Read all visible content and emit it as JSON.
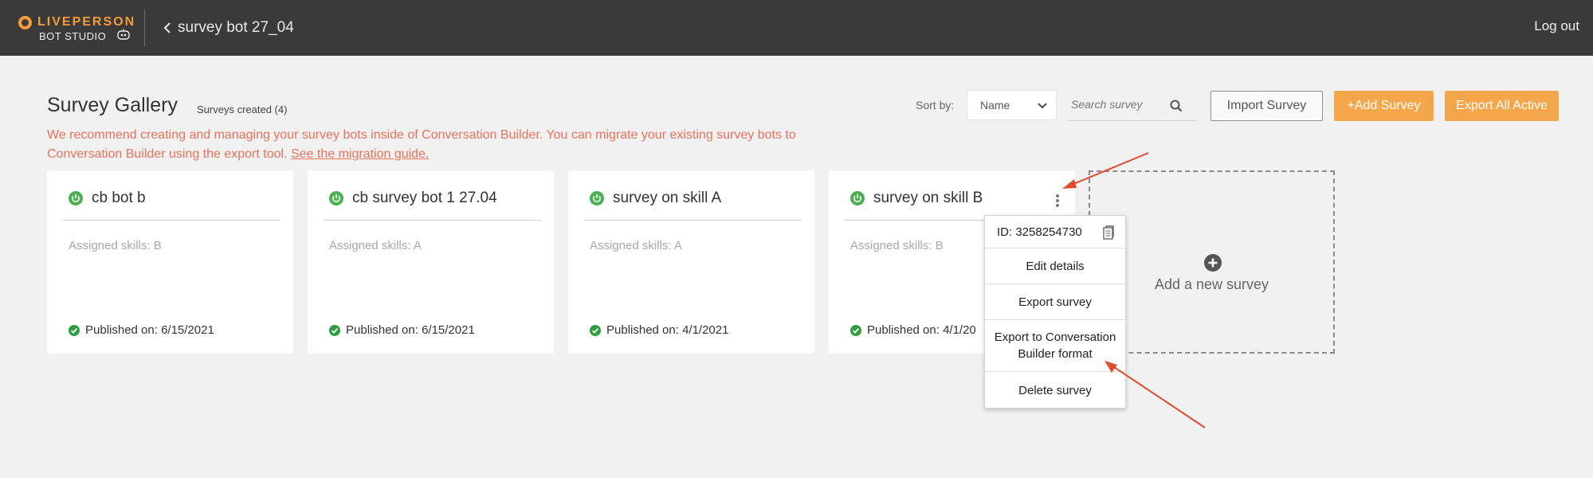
{
  "header": {
    "brand": "LIVEPERSON",
    "product": "BOT STUDIO",
    "back_title": "survey bot 27_04",
    "logout": "Log out"
  },
  "gallery": {
    "title": "Survey Gallery",
    "count_label": "Surveys created (4)",
    "notice": "We recommend creating and managing your survey bots inside of Conversation Builder. You can migrate your existing survey bots to Conversation Builder using the export tool.",
    "notice_link": "See the migration guide."
  },
  "toolbar": {
    "sort_label": "Sort by:",
    "sort_value": "Name",
    "search_placeholder": "Search survey",
    "import_label": "Import Survey",
    "add_label": "+Add Survey",
    "export_all_label": "Export All Active"
  },
  "surveys": [
    {
      "name": "cb bot b",
      "skills": "Assigned skills: B",
      "published": "Published on: 6/15/2021"
    },
    {
      "name": "cb survey bot 1 27.04",
      "skills": "Assigned skills: A",
      "published": "Published on: 6/15/2021"
    },
    {
      "name": "survey on skill A",
      "skills": "Assigned skills: A",
      "published": "Published on: 4/1/2021"
    },
    {
      "name": "survey on skill B",
      "skills": "Assigned skills: B",
      "published": "Published on: 4/1/20"
    }
  ],
  "add_new": {
    "label": "Add a new survey"
  },
  "context_menu": {
    "id_label": "ID: 3258254730",
    "items": [
      "Edit details",
      "Export survey",
      "Export to Conversation Builder format",
      "Delete survey"
    ]
  },
  "colors": {
    "topbar": "#3a3a3a",
    "accent": "#f4a64a",
    "notice": "#e8715a",
    "status_green": "#4caf50",
    "annotation_arrow": "#e04a2e"
  }
}
